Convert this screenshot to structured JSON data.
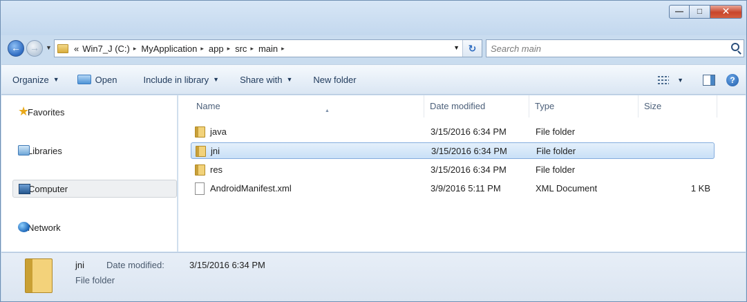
{
  "window": {
    "controls": {
      "minimize": "—",
      "maximize": "□",
      "close": "✕"
    }
  },
  "address_bar": {
    "overflow": "«",
    "crumbs": [
      "Win7_J (C:)",
      "MyApplication",
      "app",
      "src",
      "main"
    ],
    "separator": "▸"
  },
  "search": {
    "placeholder": "Search main"
  },
  "toolbar": {
    "organize": "Organize",
    "open": "Open",
    "include_in_library": "Include in library",
    "share_with": "Share with",
    "new_folder": "New folder",
    "help": "?"
  },
  "nav_pane": {
    "items": [
      {
        "label": "Favorites",
        "icon": "star-icon"
      },
      {
        "label": "Libraries",
        "icon": "libraries-icon"
      },
      {
        "label": "Computer",
        "icon": "computer-icon"
      },
      {
        "label": "Network",
        "icon": "network-icon"
      }
    ]
  },
  "file_list": {
    "columns": [
      "Name",
      "Date modified",
      "Type",
      "Size"
    ],
    "rows": [
      {
        "name": "java",
        "date": "3/15/2016 6:34 PM",
        "type": "File folder",
        "size": "",
        "icon": "folder-icon"
      },
      {
        "name": "jni",
        "date": "3/15/2016 6:34 PM",
        "type": "File folder",
        "size": "",
        "icon": "folder-icon"
      },
      {
        "name": "res",
        "date": "3/15/2016 6:34 PM",
        "type": "File folder",
        "size": "",
        "icon": "folder-icon"
      },
      {
        "name": "AndroidManifest.xml",
        "date": "3/9/2016 5:11 PM",
        "type": "XML Document",
        "size": "1 KB",
        "icon": "xml-file-icon"
      }
    ],
    "selected_index": 1
  },
  "details_pane": {
    "name": "jni",
    "type": "File folder",
    "date_label": "Date modified:",
    "date_value": "3/15/2016 6:34 PM"
  }
}
